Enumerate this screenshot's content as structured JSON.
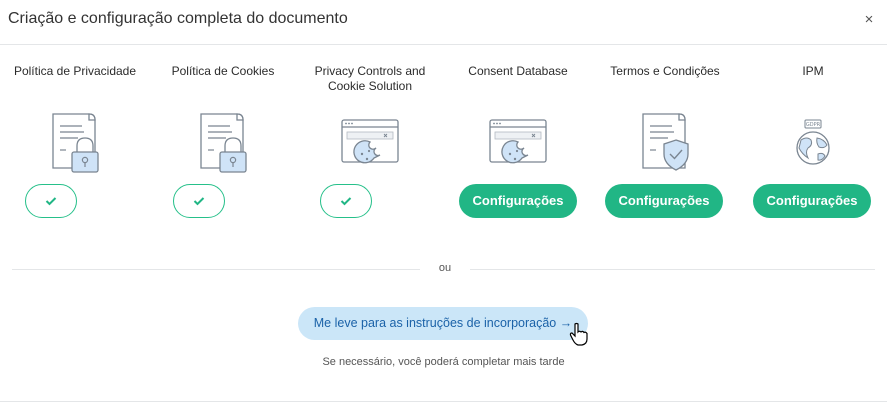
{
  "dialog": {
    "title": "Criação e configuração completa do documento",
    "close_icon": "close-icon",
    "close_glyph": "×"
  },
  "products": [
    {
      "label": "Política de Privacidade",
      "icon": "document-lock-icon",
      "state": "done"
    },
    {
      "label": "Política de Cookies",
      "icon": "document-lock-icon",
      "state": "done"
    },
    {
      "label": "Privacy Controls and Cookie Solution",
      "icon": "browser-cookie-icon",
      "state": "done"
    },
    {
      "label": "Consent Database",
      "icon": "browser-cookie-icon",
      "state": "config",
      "button_label": "Configurações"
    },
    {
      "label": "Termos e Condições",
      "icon": "document-shield-icon",
      "state": "config",
      "button_label": "Configurações"
    },
    {
      "label": "IPM",
      "icon": "gdpr-globe-icon",
      "state": "config",
      "button_label": "Configurações"
    }
  ],
  "icon_text": {
    "gdpr": "GDPR"
  },
  "separator_text": "ou",
  "embed_button_label": "Me leve para as instruções de incorporação →",
  "note": "Se necessário, você poderá completar mais tarde",
  "colors": {
    "green": "#21b685",
    "blue_bg": "#cbe6f8",
    "blue_text": "#1b62a8",
    "icon_stroke": "#7a8591",
    "icon_fill": "#cfe3f7"
  }
}
